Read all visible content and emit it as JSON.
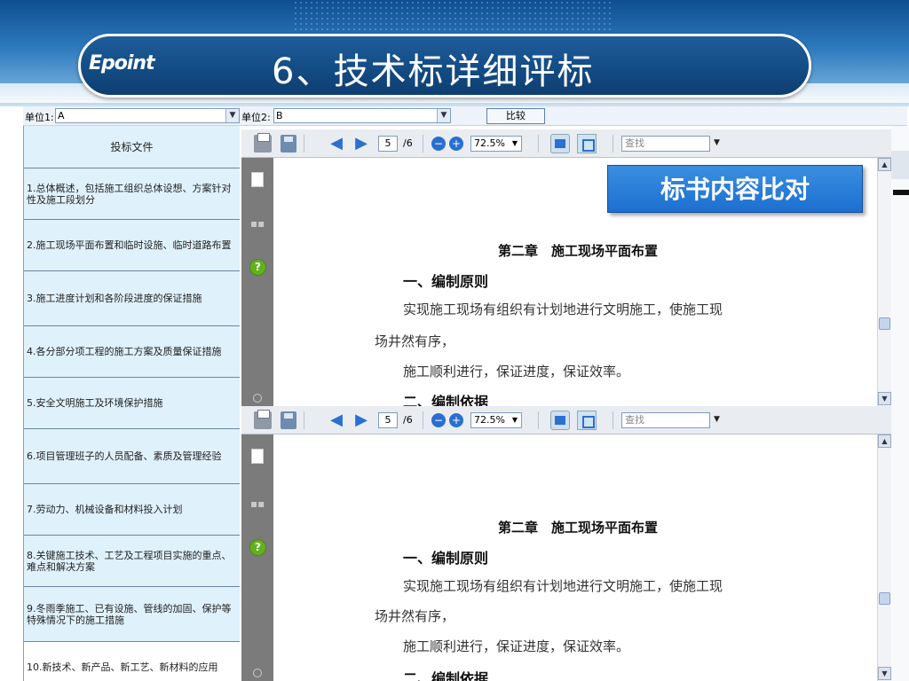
{
  "slide": {
    "logo_text": "Epoint",
    "title": "6、技术标详细评标"
  },
  "unit_bar": {
    "unit1_label": "单位1:",
    "unit1_value": "A",
    "unit2_label": "单位2:",
    "unit2_value": "B",
    "compare_button": "比较"
  },
  "left_list": {
    "header": "投标文件",
    "items": [
      "1.总体概述，包括施工组织总体设想、方案针对性及施工段划分",
      "2.施工现场平面布置和临时设施、临时道路布置",
      "3.施工进度计划和各阶段进度的保证措施",
      "4.各分部分项工程的施工方案及质量保证措施",
      "5.安全文明施工及环境保护措施",
      "6.项目管理班子的人员配备、素质及管理经验",
      "7.劳动力、机械设备和材料投入计划",
      "8.关键施工技术、工艺及工程项目实施的重点、难点和解决方案",
      "9.冬雨季施工、已有设施、管线的加固、保护等特殊情况下的施工措施",
      "10.新技术、新产品、新工艺、新材料的应用"
    ],
    "selected_index": 9
  },
  "viewer_toolbar": {
    "page_current": "5",
    "page_total": "/6",
    "zoom": "72.5%",
    "find_placeholder": "查找"
  },
  "document": {
    "chapter": "第二章　施工现场平面布置",
    "section1": "一、编制原则",
    "para1_line1": "实现施工现场有组织有计划地进行文明施工，使施工现",
    "para1_line2": "场井然有序，",
    "para2": "施工顺利进行，保证进度，保证效率。",
    "section2_partial": "二、编制依据"
  },
  "callout": "标书内容比对",
  "colors": {
    "header_blue": "#144c85",
    "list_bg": "#dff1fb",
    "callout_blue": "#1c6fd0",
    "help_green": "#62b01f"
  }
}
